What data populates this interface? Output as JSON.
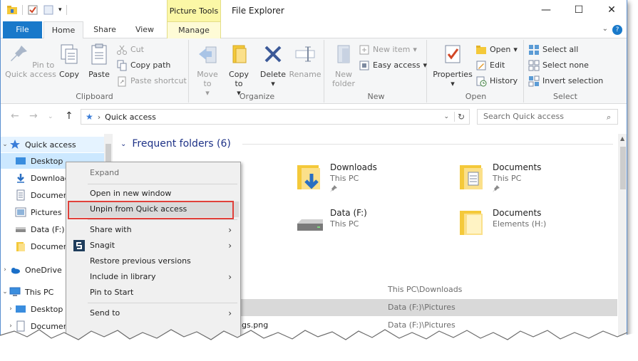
{
  "window": {
    "title": "File Explorer",
    "contextual_tab_group": "Picture Tools",
    "controls": {
      "minimize": "—",
      "maximize": "☐",
      "close": "✕"
    }
  },
  "tabs": [
    {
      "label": "File"
    },
    {
      "label": "Home"
    },
    {
      "label": "Share"
    },
    {
      "label": "View"
    },
    {
      "label": "Manage"
    }
  ],
  "ribbon": {
    "clipboard": {
      "label": "Clipboard",
      "pin_to_quick_access": "Pin to Quick access",
      "copy": "Copy",
      "paste": "Paste",
      "cut": "Cut",
      "copy_path": "Copy path",
      "paste_shortcut": "Paste shortcut"
    },
    "organize": {
      "label": "Organize",
      "move_to": "Move to",
      "copy_to": "Copy to",
      "delete": "Delete",
      "rename": "Rename"
    },
    "new": {
      "label": "New",
      "new_folder": "New folder",
      "new_item": "New item",
      "easy_access": "Easy access"
    },
    "open": {
      "label": "Open",
      "properties": "Properties",
      "open": "Open",
      "edit": "Edit",
      "history": "History"
    },
    "select": {
      "label": "Select",
      "select_all": "Select all",
      "select_none": "Select none",
      "invert_selection": "Invert selection"
    }
  },
  "address": {
    "path": "Quick access",
    "search_placeholder": "Search Quick access"
  },
  "navpane": {
    "items": [
      {
        "label": "Quick access"
      },
      {
        "label": "Desktop"
      },
      {
        "label": "Downloads"
      },
      {
        "label": "Documents"
      },
      {
        "label": "Pictures"
      },
      {
        "label": "Data (F:)"
      },
      {
        "label": "Documents"
      },
      {
        "label": "OneDrive"
      },
      {
        "label": "This PC"
      },
      {
        "label": "Desktop"
      },
      {
        "label": "Documents"
      }
    ]
  },
  "content": {
    "frequent_header": "Frequent folders (6)",
    "folders": [
      {
        "name": "Downloads",
        "location": "This PC"
      },
      {
        "name": "Documents",
        "location": "This PC"
      },
      {
        "name": "Data (F:)",
        "location": "This PC"
      },
      {
        "name": "Documents",
        "location": "Elements (H:)"
      }
    ],
    "recent": [
      {
        "name": "",
        "location": "This PC\\Downloads"
      },
      {
        "name": "",
        "location": "Data (F:)\\Pictures"
      },
      {
        "name": "ings.png",
        "location": "Data (F:)\\Pictures"
      }
    ]
  },
  "context_menu": {
    "items": [
      {
        "label": "Expand"
      },
      {
        "label": "Open in new window"
      },
      {
        "label": "Unpin from Quick access"
      },
      {
        "label": "Share with"
      },
      {
        "label": "Snagit"
      },
      {
        "label": "Restore previous versions"
      },
      {
        "label": "Include in library"
      },
      {
        "label": "Pin to Start"
      },
      {
        "label": "Send to"
      }
    ]
  },
  "colors": {
    "accent": "#1979ca",
    "picture_tools": "#fbf7a6",
    "selection": "#cce8ff",
    "highlight_box": "#e0403a"
  }
}
